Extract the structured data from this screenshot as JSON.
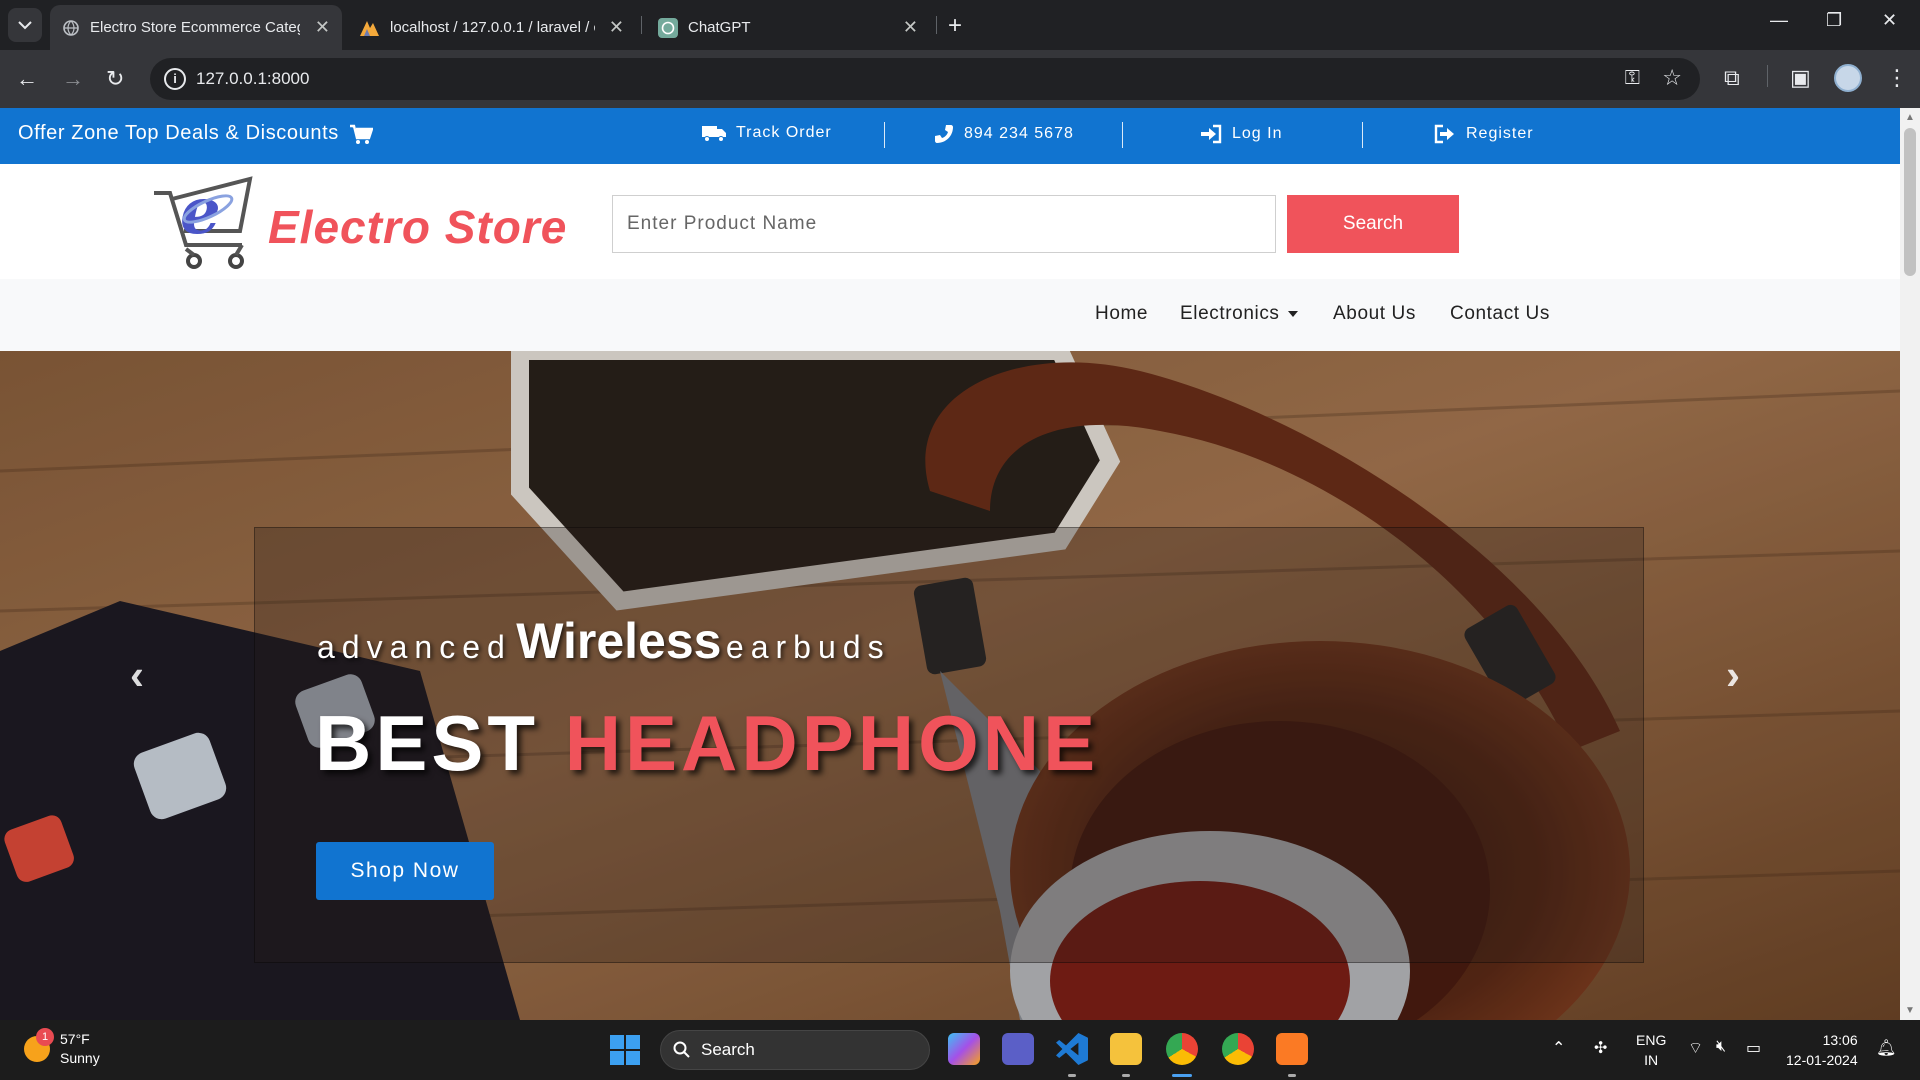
{
  "browser": {
    "tabs": [
      {
        "title": "Electro Store Ecommerce Categ",
        "icon": "globe-icon",
        "active": true
      },
      {
        "title": "localhost / 127.0.0.1 / laravel / c",
        "icon": "phpmyadmin-icon",
        "active": false
      },
      {
        "title": "ChatGPT",
        "icon": "chatgpt-icon",
        "active": false
      }
    ],
    "url": "127.0.0.1:8000"
  },
  "topbar": {
    "offer": "Offer Zone Top Deals & Discounts",
    "track": "Track Order",
    "phone": "894 234 5678",
    "login": "Log In",
    "register": "Register"
  },
  "header": {
    "brand": "Electro Store",
    "search_placeholder": "Enter Product Name",
    "search_label": "Search"
  },
  "nav": {
    "items": [
      "Home",
      "Electronics",
      "About Us",
      "Contact Us"
    ]
  },
  "hero": {
    "tag_pre": "advanced",
    "tag_mid": "Wireless",
    "tag_post": "earbuds",
    "headline_white": "BEST",
    "headline_red": "HEADPHONE",
    "cta": "Shop Now"
  },
  "taskbar": {
    "weather_badge": "1",
    "temp": "57°F",
    "condition": "Sunny",
    "search": "Search",
    "lang_top": "ENG",
    "lang_bottom": "IN",
    "time": "13:06",
    "date": "12-01-2024"
  },
  "colors": {
    "accent_blue": "#1174d0",
    "brand_red": "#f0535b"
  }
}
